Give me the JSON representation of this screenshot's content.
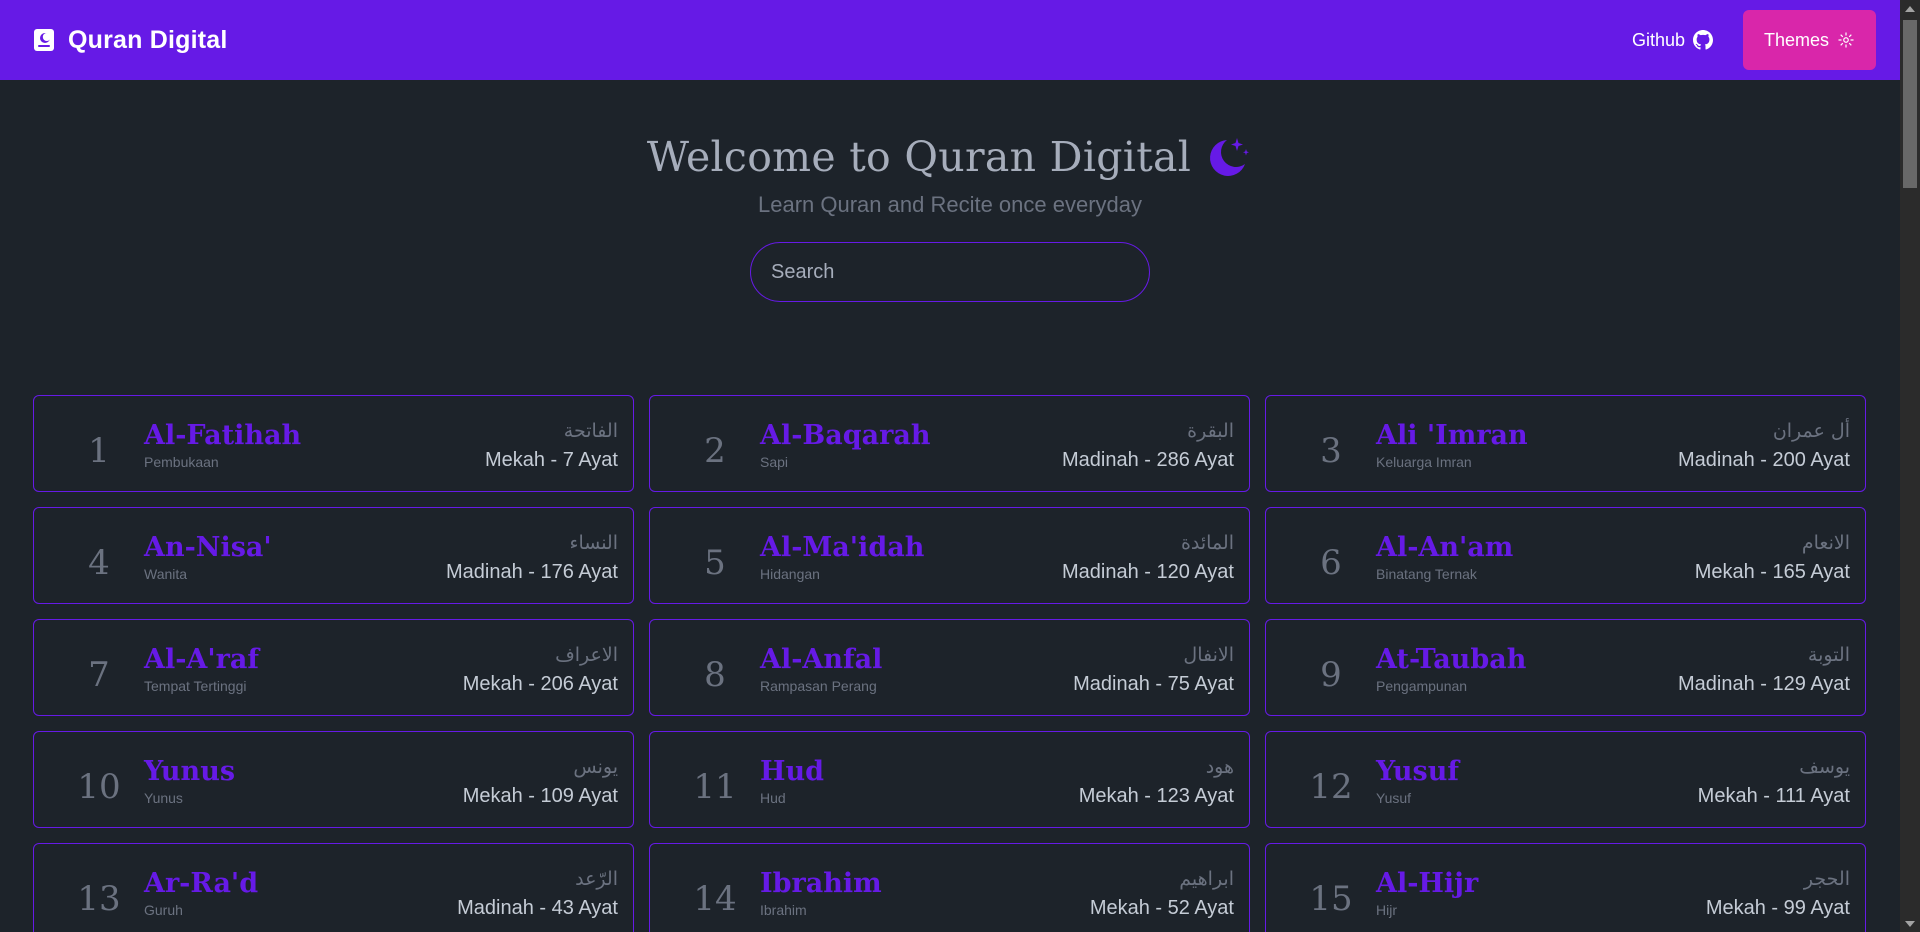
{
  "navbar": {
    "brand_title": "Quran Digital",
    "github_label": "Github",
    "themes_label": "Themes"
  },
  "hero": {
    "title": "Welcome to Quran Digital",
    "subtitle": "Learn Quran and Recite once everyday",
    "search_placeholder": "Search"
  },
  "colors": {
    "primary": "#661ae6",
    "secondary": "#d926aa",
    "background": "#1d232a",
    "text": "#a6adbb"
  },
  "surahs": [
    {
      "number": "1",
      "name": "Al-Fatihah",
      "translation": "Pembukaan",
      "arabic": "الفاتحة",
      "meta": "Mekah - 7 Ayat"
    },
    {
      "number": "2",
      "name": "Al-Baqarah",
      "translation": "Sapi",
      "arabic": "البقرة",
      "meta": "Madinah - 286 Ayat"
    },
    {
      "number": "3",
      "name": "Ali 'Imran",
      "translation": "Keluarga Imran",
      "arabic": "أل عمران",
      "meta": "Madinah - 200 Ayat"
    },
    {
      "number": "4",
      "name": "An-Nisa'",
      "translation": "Wanita",
      "arabic": "النساء",
      "meta": "Madinah - 176 Ayat"
    },
    {
      "number": "5",
      "name": "Al-Ma'idah",
      "translation": "Hidangan",
      "arabic": "المائدة",
      "meta": "Madinah - 120 Ayat"
    },
    {
      "number": "6",
      "name": "Al-An'am",
      "translation": "Binatang Ternak",
      "arabic": "الانعام",
      "meta": "Mekah - 165 Ayat"
    },
    {
      "number": "7",
      "name": "Al-A'raf",
      "translation": "Tempat Tertinggi",
      "arabic": "الاعراف",
      "meta": "Mekah - 206 Ayat"
    },
    {
      "number": "8",
      "name": "Al-Anfal",
      "translation": "Rampasan Perang",
      "arabic": "الانفال",
      "meta": "Madinah - 75 Ayat"
    },
    {
      "number": "9",
      "name": "At-Taubah",
      "translation": "Pengampunan",
      "arabic": "التوبة",
      "meta": "Madinah - 129 Ayat"
    },
    {
      "number": "10",
      "name": "Yunus",
      "translation": "Yunus",
      "arabic": "يونس",
      "meta": "Mekah - 109 Ayat"
    },
    {
      "number": "11",
      "name": "Hud",
      "translation": "Hud",
      "arabic": "هود",
      "meta": "Mekah - 123 Ayat"
    },
    {
      "number": "12",
      "name": "Yusuf",
      "translation": "Yusuf",
      "arabic": "يوسف",
      "meta": "Mekah - 111 Ayat"
    },
    {
      "number": "13",
      "name": "Ar-Ra'd",
      "translation": "Guruh",
      "arabic": "الرّعد",
      "meta": "Madinah - 43 Ayat"
    },
    {
      "number": "14",
      "name": "Ibrahim",
      "translation": "Ibrahim",
      "arabic": "ابراهيم",
      "meta": "Mekah - 52 Ayat"
    },
    {
      "number": "15",
      "name": "Al-Hijr",
      "translation": "Hijr",
      "arabic": "الحجر",
      "meta": "Mekah - 99 Ayat"
    }
  ]
}
